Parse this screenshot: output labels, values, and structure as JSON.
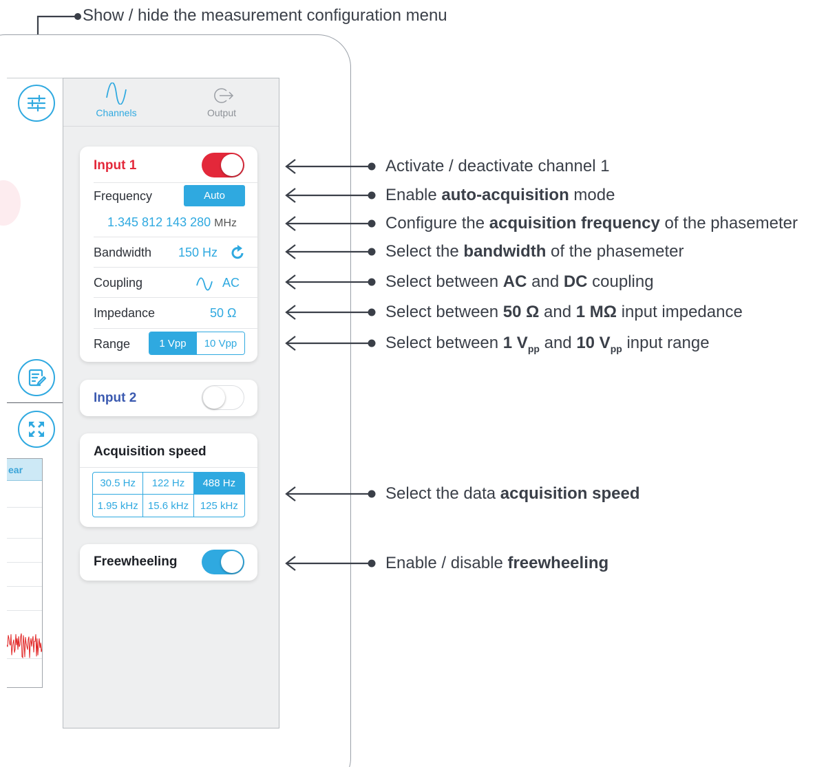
{
  "top_annotation": "Show / hide the measurement configuration menu",
  "tabs": {
    "channels": "Channels",
    "output": "Output"
  },
  "mini_plot": {
    "header_fragment": "ear"
  },
  "input1": {
    "title": "Input 1",
    "enabled": true,
    "frequency_label": "Frequency",
    "auto_button": "Auto",
    "frequency_value": "1.345 812 143 280",
    "frequency_unit": "MHz",
    "bandwidth_label": "Bandwidth",
    "bandwidth_value": "150 Hz",
    "coupling_label": "Coupling",
    "coupling_value": "AC",
    "impedance_label": "Impedance",
    "impedance_value": "50 Ω",
    "range_label": "Range",
    "range_options": [
      "1 Vpp",
      "10 Vpp"
    ],
    "range_selected": "1 Vpp"
  },
  "input2": {
    "title": "Input 2",
    "enabled": false
  },
  "acquisition": {
    "title": "Acquisition speed",
    "options": [
      "30.5 Hz",
      "122 Hz",
      "488 Hz",
      "1.95 kHz",
      "15.6 kHz",
      "125 kHz"
    ],
    "selected": "488 Hz"
  },
  "freewheeling": {
    "title": "Freewheeling",
    "enabled": true
  },
  "annotations": [
    {
      "parts": [
        [
          "Activate / deactivate channel 1",
          false
        ]
      ]
    },
    {
      "parts": [
        [
          "Enable ",
          false
        ],
        [
          "auto-acquisition",
          true
        ],
        [
          " mode",
          false
        ]
      ]
    },
    {
      "parts": [
        [
          "Configure the ",
          false
        ],
        [
          "acquisition frequency",
          true
        ],
        [
          " of the phasemeter",
          false
        ]
      ]
    },
    {
      "parts": [
        [
          "Select the ",
          false
        ],
        [
          "bandwidth",
          true
        ],
        [
          " of the phasemeter",
          false
        ]
      ]
    },
    {
      "parts": [
        [
          "Select between ",
          false
        ],
        [
          "AC",
          true
        ],
        [
          " and ",
          false
        ],
        [
          "DC",
          true
        ],
        [
          " coupling",
          false
        ]
      ]
    },
    {
      "parts": [
        [
          "Select between ",
          false
        ],
        [
          "50 Ω",
          true
        ],
        [
          " and ",
          false
        ],
        [
          "1 MΩ",
          true
        ],
        [
          " input impedance",
          false
        ]
      ]
    },
    {
      "parts": [
        [
          "Select between ",
          false
        ],
        [
          "1 V",
          true
        ],
        [
          "pp",
          "sub"
        ],
        [
          " and ",
          false
        ],
        [
          "10 V",
          true
        ],
        [
          "pp",
          "sub"
        ],
        [
          " input range",
          false
        ]
      ]
    },
    {
      "parts": [
        [
          "Select the data ",
          false
        ],
        [
          "acquisition speed",
          true
        ]
      ]
    },
    {
      "parts": [
        [
          "Enable / disable ",
          false
        ],
        [
          "freewheeling",
          true
        ]
      ]
    }
  ],
  "colors": {
    "accent": "#2fa9e0",
    "input1_red": "#e3283a",
    "input2_blue": "#3b5ab0",
    "plot_signal": "#e02020"
  }
}
